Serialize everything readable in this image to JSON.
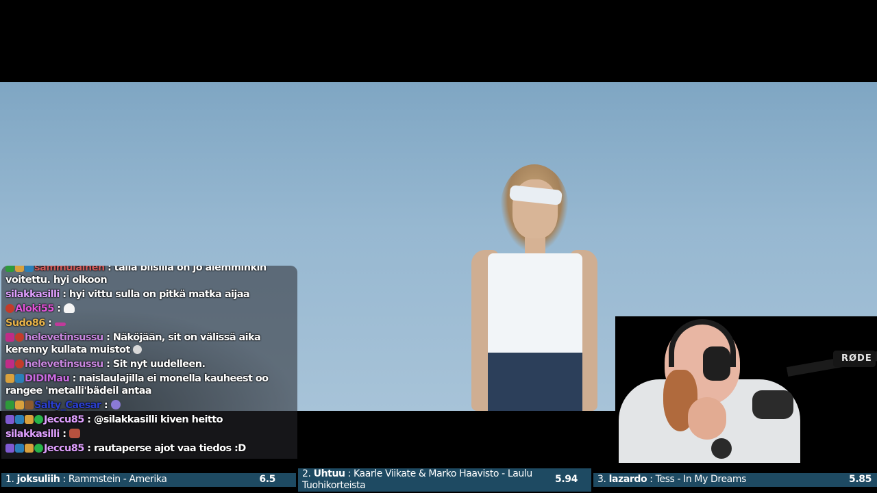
{
  "chat": {
    "messages": [
      {
        "user": "sammulainen",
        "text": ": tällä biisillä on jo aiemminkin voitettu. hyi olkoon",
        "color": "#d05a5a",
        "badges": [
          "green",
          "crown",
          "blue"
        ],
        "emote": null
      },
      {
        "user": "silakkasilli",
        "text": ": hyi vittu sulla on pitkä matka aijaa",
        "color": "#e0a0ff",
        "badges": [],
        "emote": null
      },
      {
        "user": "Aloki55",
        "text": ":",
        "color": "#e055d8",
        "badges": [
          "red"
        ],
        "emote": "ghost"
      },
      {
        "user": "Sudo86",
        "text": ":",
        "color": "#e6b24a",
        "badges": [],
        "emote": "pink"
      },
      {
        "user": "helevetinsussu",
        "text": ": Näköjään, sit on välissä aika kerenny kullata muistot",
        "color": "#c987e0",
        "badges": [
          "heart",
          "red"
        ],
        "emote": "face"
      },
      {
        "user": "helevetinsussu",
        "text": ": Sit nyt uudelleen.",
        "color": "#c987e0",
        "badges": [
          "heart",
          "red"
        ],
        "emote": null
      },
      {
        "user": "DIDIMau",
        "text": ": naislaulajilla ei monella kauheest oo rangee 'metalli'bädeil antaa",
        "color": "#c96be0",
        "badges": [
          "crown",
          "blue"
        ],
        "emote": null
      },
      {
        "user": "Salty_Caesar",
        "text": ":",
        "color": "#2a3fd0",
        "badges": [
          "green",
          "crown",
          "gift"
        ],
        "emote": "orb"
      },
      {
        "user": "Jeccu85",
        "text": ": @silakkasilli kiven heitto",
        "color": "#e0a0ff",
        "badges": [
          "purple",
          "blue",
          "crown",
          "check"
        ],
        "emote": null
      },
      {
        "user": "silakkasilli",
        "text": ":",
        "color": "#e0a0ff",
        "badges": [],
        "emote": "brick"
      },
      {
        "user": "Jeccu85",
        "text": ": rautaperse ajot vaa tiedos :D",
        "color": "#e0a0ff",
        "badges": [
          "purple",
          "blue",
          "crown",
          "check"
        ],
        "emote": null
      }
    ]
  },
  "webcam": {
    "mic_brand": "RØDE"
  },
  "scoreboard": [
    {
      "rank": "1.",
      "name": "joksuliih",
      "song": ": Rammstein - Amerika",
      "score": "6.5"
    },
    {
      "rank": "2.",
      "name": "Uhtuu",
      "song": ": Kaarle Viikate & Marko Haavisto - Laulu Tuohikorteista",
      "score": "5.94"
    },
    {
      "rank": "3.",
      "name": "lazardo",
      "song": ": Tess - In My Dreams",
      "score": "5.85"
    }
  ]
}
